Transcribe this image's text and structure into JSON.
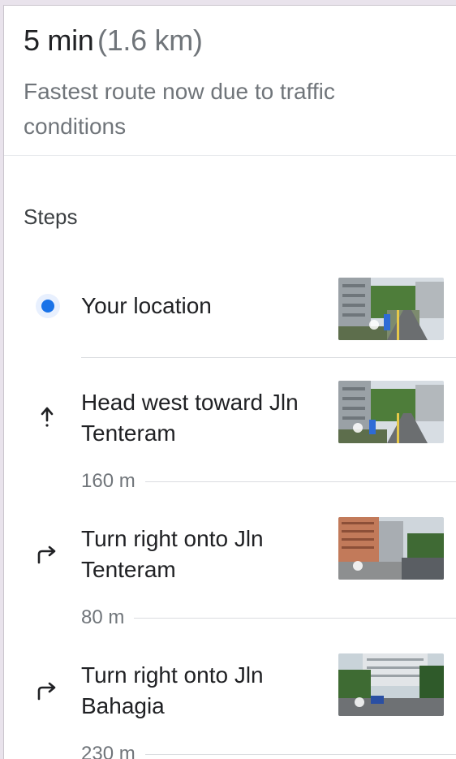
{
  "summary": {
    "time": "5 min",
    "distance": "(1.6 km)",
    "note": "Fastest route now due to traffic conditions"
  },
  "steps_title": "Steps",
  "steps": [
    {
      "text": "Your location",
      "icon": "location-dot-icon"
    },
    {
      "text": "Head west toward Jln Tenteram",
      "icon": "arrow-up-icon",
      "distance": "160 m"
    },
    {
      "text": "Turn right onto Jln Tenteram",
      "icon": "turn-right-icon",
      "distance": "80 m"
    },
    {
      "text": "Turn right onto Jln Bahagia",
      "icon": "turn-right-icon",
      "distance": "230 m"
    }
  ],
  "colors": {
    "accent": "#1a73e8",
    "text": "#202124",
    "muted": "#70757a"
  }
}
